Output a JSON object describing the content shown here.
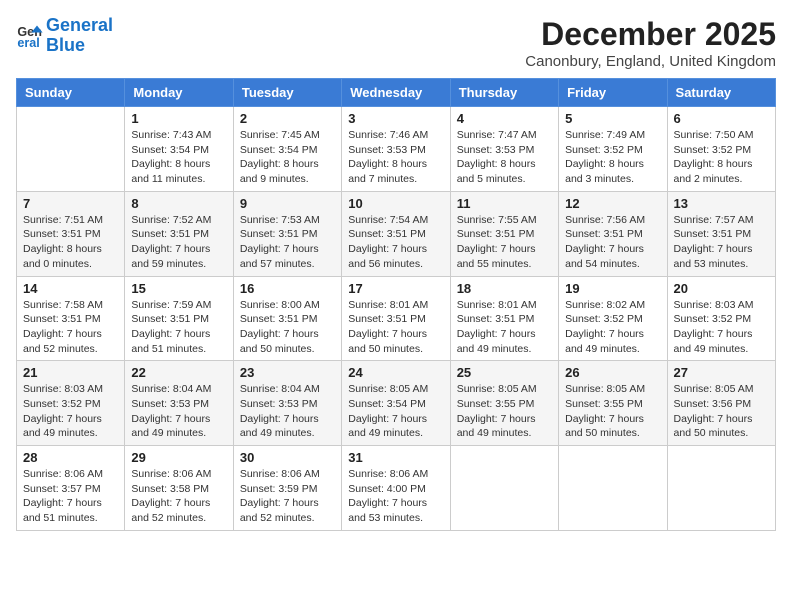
{
  "logo": {
    "line1": "General",
    "line2": "Blue"
  },
  "title": "December 2025",
  "location": "Canonbury, England, United Kingdom",
  "days_of_week": [
    "Sunday",
    "Monday",
    "Tuesday",
    "Wednesday",
    "Thursday",
    "Friday",
    "Saturday"
  ],
  "weeks": [
    [
      {
        "day": "",
        "info": ""
      },
      {
        "day": "1",
        "info": "Sunrise: 7:43 AM\nSunset: 3:54 PM\nDaylight: 8 hours\nand 11 minutes."
      },
      {
        "day": "2",
        "info": "Sunrise: 7:45 AM\nSunset: 3:54 PM\nDaylight: 8 hours\nand 9 minutes."
      },
      {
        "day": "3",
        "info": "Sunrise: 7:46 AM\nSunset: 3:53 PM\nDaylight: 8 hours\nand 7 minutes."
      },
      {
        "day": "4",
        "info": "Sunrise: 7:47 AM\nSunset: 3:53 PM\nDaylight: 8 hours\nand 5 minutes."
      },
      {
        "day": "5",
        "info": "Sunrise: 7:49 AM\nSunset: 3:52 PM\nDaylight: 8 hours\nand 3 minutes."
      },
      {
        "day": "6",
        "info": "Sunrise: 7:50 AM\nSunset: 3:52 PM\nDaylight: 8 hours\nand 2 minutes."
      }
    ],
    [
      {
        "day": "7",
        "info": "Sunrise: 7:51 AM\nSunset: 3:51 PM\nDaylight: 8 hours\nand 0 minutes."
      },
      {
        "day": "8",
        "info": "Sunrise: 7:52 AM\nSunset: 3:51 PM\nDaylight: 7 hours\nand 59 minutes."
      },
      {
        "day": "9",
        "info": "Sunrise: 7:53 AM\nSunset: 3:51 PM\nDaylight: 7 hours\nand 57 minutes."
      },
      {
        "day": "10",
        "info": "Sunrise: 7:54 AM\nSunset: 3:51 PM\nDaylight: 7 hours\nand 56 minutes."
      },
      {
        "day": "11",
        "info": "Sunrise: 7:55 AM\nSunset: 3:51 PM\nDaylight: 7 hours\nand 55 minutes."
      },
      {
        "day": "12",
        "info": "Sunrise: 7:56 AM\nSunset: 3:51 PM\nDaylight: 7 hours\nand 54 minutes."
      },
      {
        "day": "13",
        "info": "Sunrise: 7:57 AM\nSunset: 3:51 PM\nDaylight: 7 hours\nand 53 minutes."
      }
    ],
    [
      {
        "day": "14",
        "info": "Sunrise: 7:58 AM\nSunset: 3:51 PM\nDaylight: 7 hours\nand 52 minutes."
      },
      {
        "day": "15",
        "info": "Sunrise: 7:59 AM\nSunset: 3:51 PM\nDaylight: 7 hours\nand 51 minutes."
      },
      {
        "day": "16",
        "info": "Sunrise: 8:00 AM\nSunset: 3:51 PM\nDaylight: 7 hours\nand 50 minutes."
      },
      {
        "day": "17",
        "info": "Sunrise: 8:01 AM\nSunset: 3:51 PM\nDaylight: 7 hours\nand 50 minutes."
      },
      {
        "day": "18",
        "info": "Sunrise: 8:01 AM\nSunset: 3:51 PM\nDaylight: 7 hours\nand 49 minutes."
      },
      {
        "day": "19",
        "info": "Sunrise: 8:02 AM\nSunset: 3:52 PM\nDaylight: 7 hours\nand 49 minutes."
      },
      {
        "day": "20",
        "info": "Sunrise: 8:03 AM\nSunset: 3:52 PM\nDaylight: 7 hours\nand 49 minutes."
      }
    ],
    [
      {
        "day": "21",
        "info": "Sunrise: 8:03 AM\nSunset: 3:52 PM\nDaylight: 7 hours\nand 49 minutes."
      },
      {
        "day": "22",
        "info": "Sunrise: 8:04 AM\nSunset: 3:53 PM\nDaylight: 7 hours\nand 49 minutes."
      },
      {
        "day": "23",
        "info": "Sunrise: 8:04 AM\nSunset: 3:53 PM\nDaylight: 7 hours\nand 49 minutes."
      },
      {
        "day": "24",
        "info": "Sunrise: 8:05 AM\nSunset: 3:54 PM\nDaylight: 7 hours\nand 49 minutes."
      },
      {
        "day": "25",
        "info": "Sunrise: 8:05 AM\nSunset: 3:55 PM\nDaylight: 7 hours\nand 49 minutes."
      },
      {
        "day": "26",
        "info": "Sunrise: 8:05 AM\nSunset: 3:55 PM\nDaylight: 7 hours\nand 50 minutes."
      },
      {
        "day": "27",
        "info": "Sunrise: 8:05 AM\nSunset: 3:56 PM\nDaylight: 7 hours\nand 50 minutes."
      }
    ],
    [
      {
        "day": "28",
        "info": "Sunrise: 8:06 AM\nSunset: 3:57 PM\nDaylight: 7 hours\nand 51 minutes."
      },
      {
        "day": "29",
        "info": "Sunrise: 8:06 AM\nSunset: 3:58 PM\nDaylight: 7 hours\nand 52 minutes."
      },
      {
        "day": "30",
        "info": "Sunrise: 8:06 AM\nSunset: 3:59 PM\nDaylight: 7 hours\nand 52 minutes."
      },
      {
        "day": "31",
        "info": "Sunrise: 8:06 AM\nSunset: 4:00 PM\nDaylight: 7 hours\nand 53 minutes."
      },
      {
        "day": "",
        "info": ""
      },
      {
        "day": "",
        "info": ""
      },
      {
        "day": "",
        "info": ""
      }
    ]
  ]
}
